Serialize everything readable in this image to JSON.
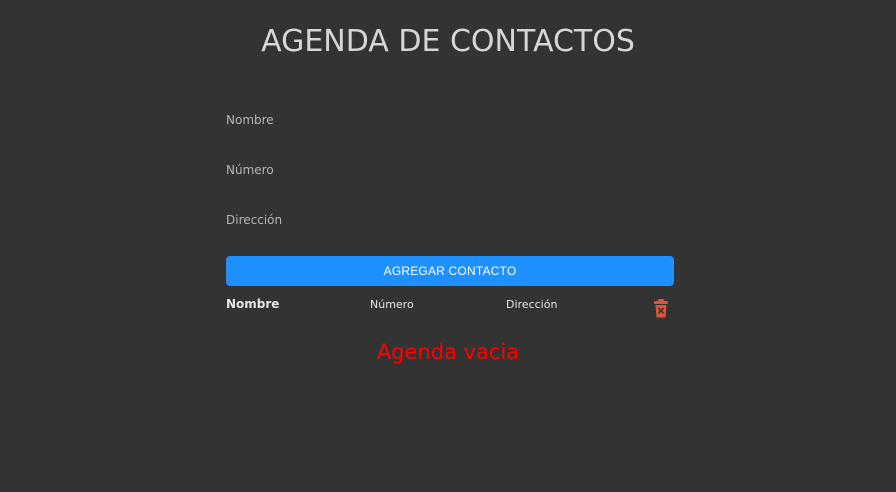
{
  "header": {
    "title": "AGENDA DE CONTACTOS"
  },
  "form": {
    "name_placeholder": "Nombre",
    "number_placeholder": "Número",
    "address_placeholder": "Dirección",
    "name_value": "",
    "number_value": "",
    "address_value": "",
    "submit_label": "AGREGAR CONTACTO"
  },
  "table": {
    "columns": [
      "Nombre",
      "Número",
      "Dirección"
    ],
    "delete_all_icon": "trash-icon"
  },
  "empty_message": "Agenda vacia",
  "colors": {
    "background": "#333333",
    "accent": "#1e90ff",
    "empty_text": "#ff0000",
    "trash": "#e2533d"
  }
}
